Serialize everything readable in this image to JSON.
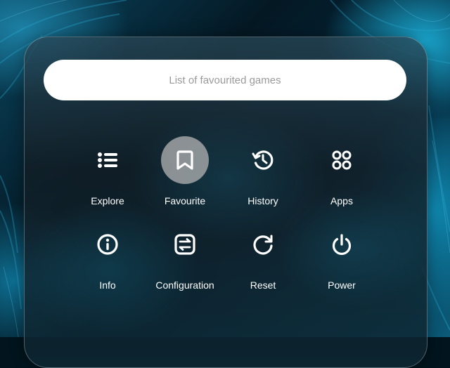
{
  "search": {
    "text": "List of favourited games"
  },
  "menu": {
    "items": [
      {
        "label": "Explore",
        "icon": "list-icon",
        "selected": false
      },
      {
        "label": "Favourite",
        "icon": "bookmark-icon",
        "selected": true
      },
      {
        "label": "History",
        "icon": "history-icon",
        "selected": false
      },
      {
        "label": "Apps",
        "icon": "apps-grid-icon",
        "selected": false
      },
      {
        "label": "Info",
        "icon": "info-icon",
        "selected": false
      },
      {
        "label": "Configuration",
        "icon": "configuration-icon",
        "selected": false
      },
      {
        "label": "Reset",
        "icon": "reset-icon",
        "selected": false
      },
      {
        "label": "Power",
        "icon": "power-icon",
        "selected": false
      }
    ]
  },
  "colors": {
    "selected_highlight": "#b4b4b4",
    "search_bg": "#ffffff",
    "search_text": "#9a9a9a",
    "label_text": "#ffffff"
  }
}
